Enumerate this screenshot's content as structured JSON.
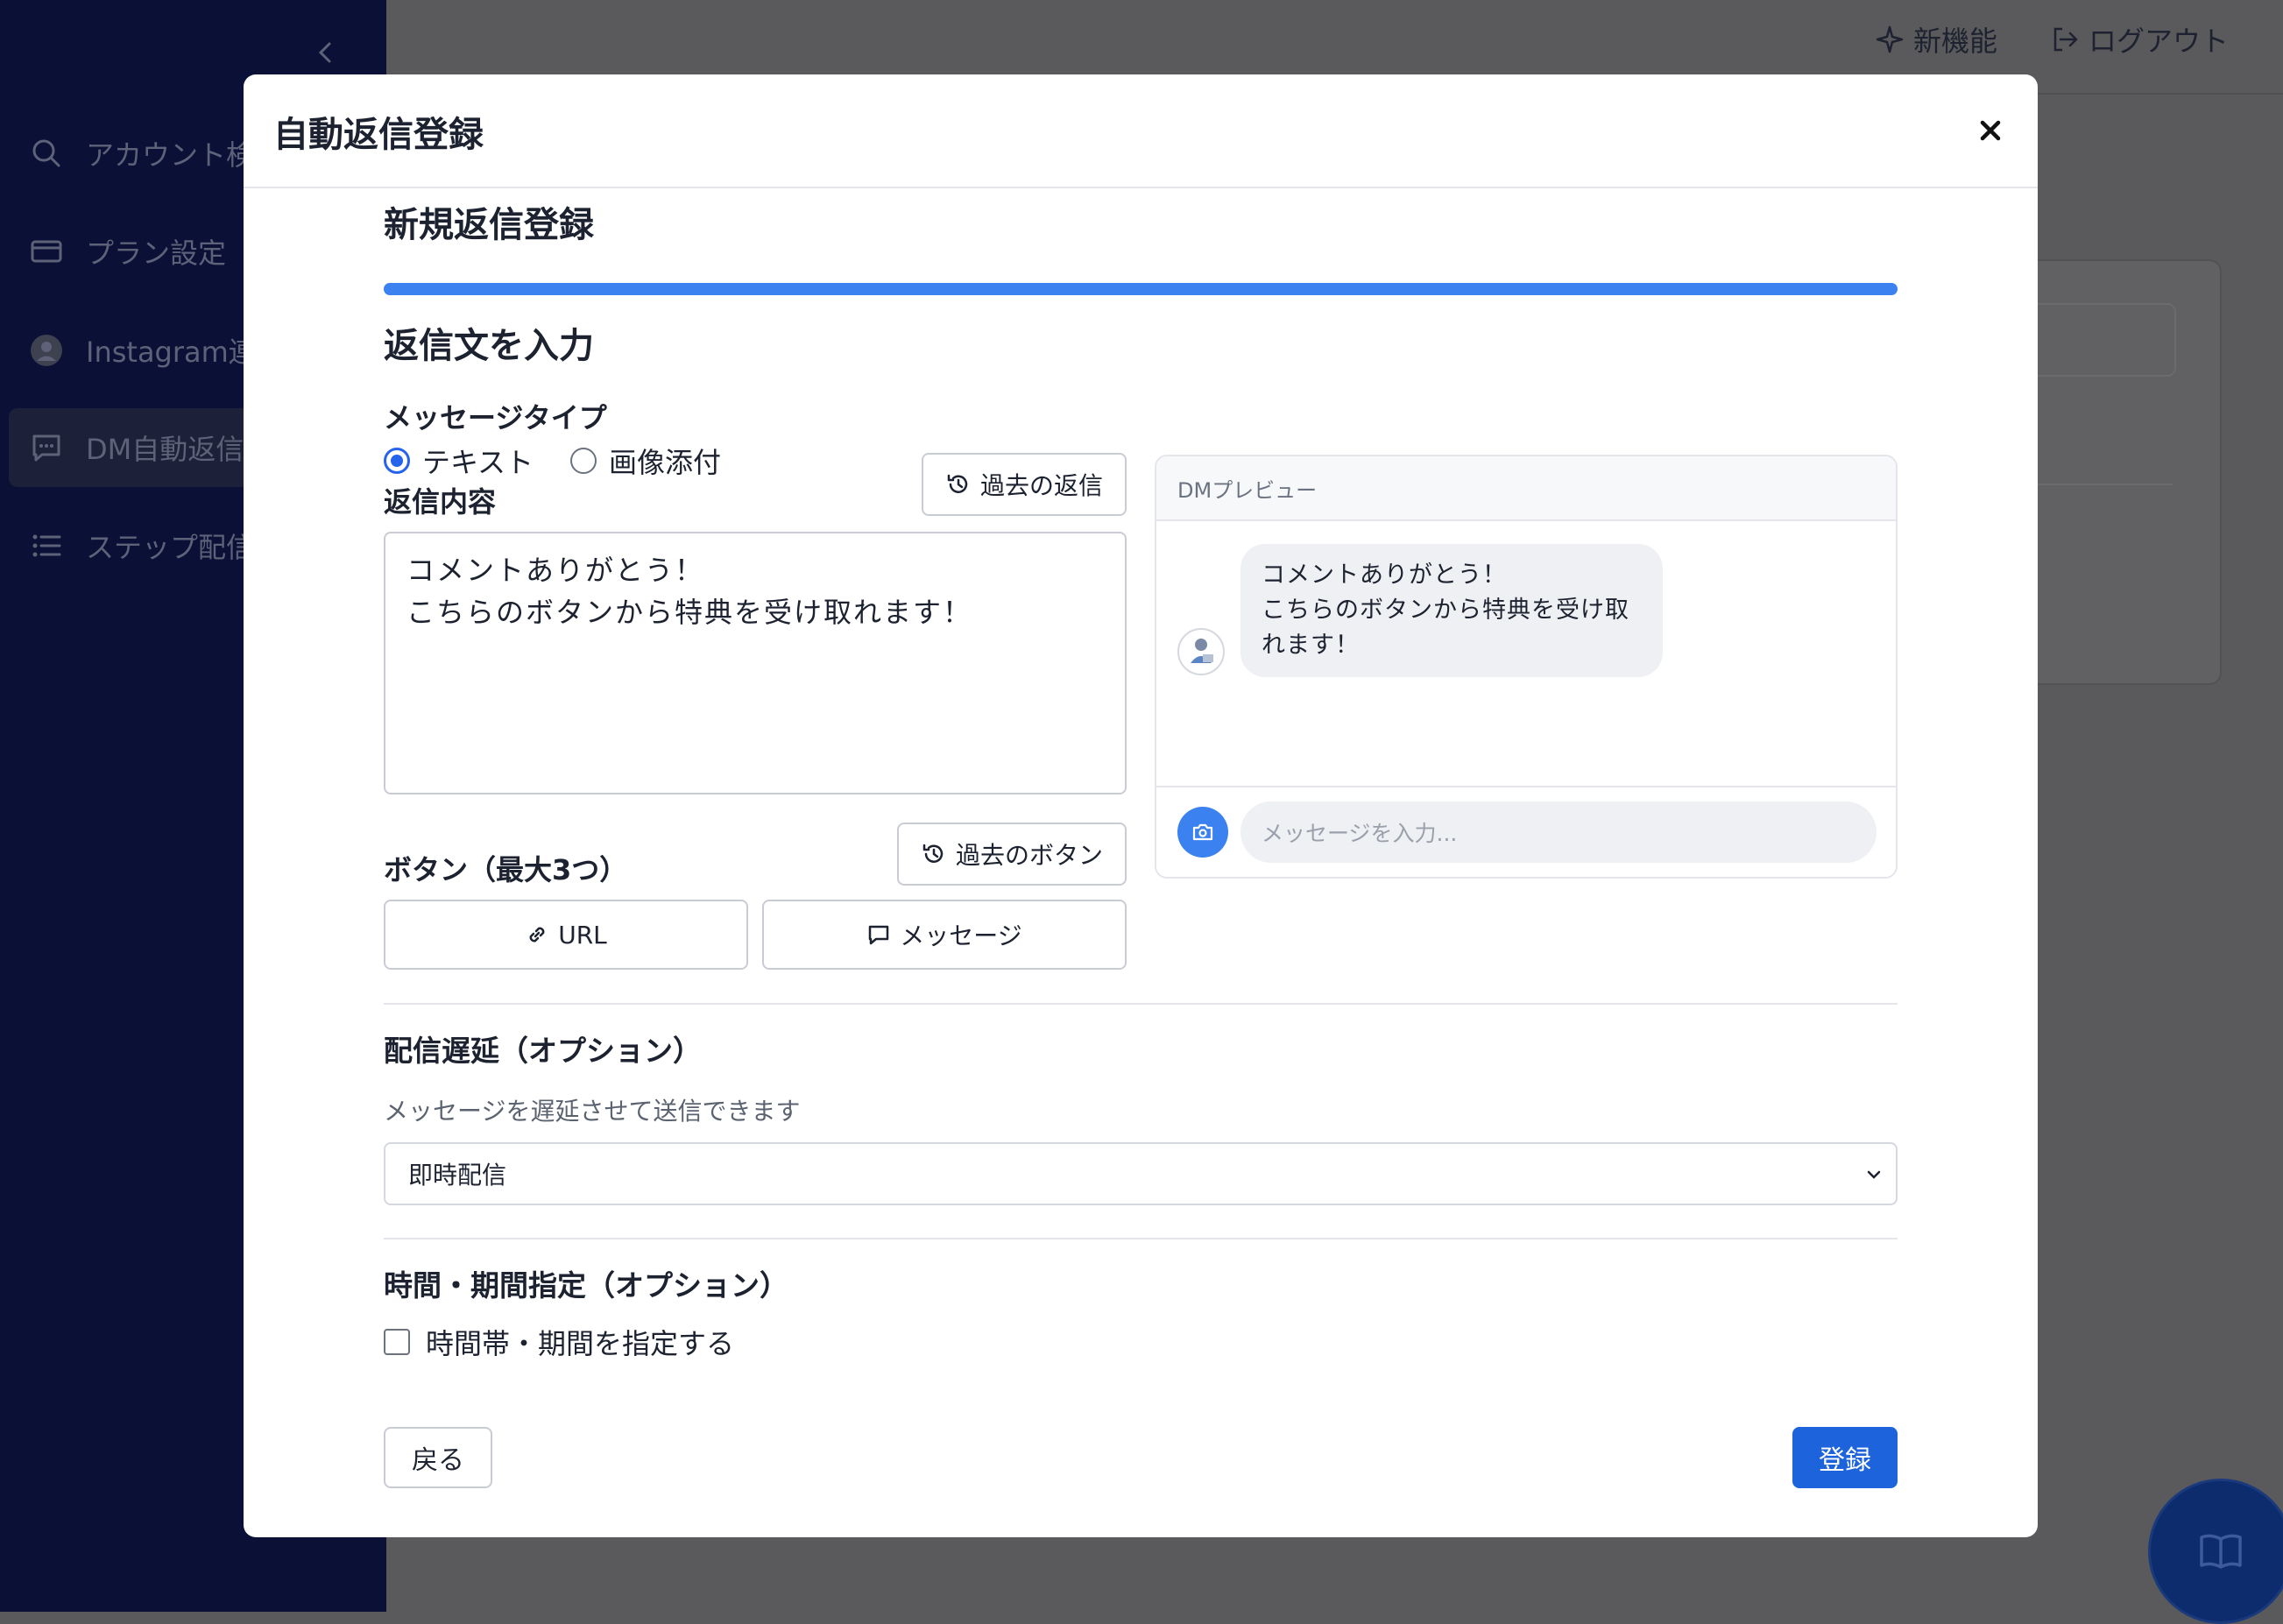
{
  "sidebar": {
    "items": [
      {
        "label": "アカウント検索",
        "icon": "search-icon"
      },
      {
        "label": "プラン設定",
        "icon": "card-icon"
      },
      {
        "label": "Instagram連携",
        "icon": "avatar-icon"
      },
      {
        "label": "DM自動返信",
        "icon": "chat-icon",
        "active": true
      },
      {
        "label": "ステップ配信",
        "icon": "list-icon"
      }
    ]
  },
  "header": {
    "new_features": "新機能",
    "logout": "ログアウト"
  },
  "modal": {
    "title": "自動返信登録",
    "heading": "新規返信登録",
    "progress": 1.0,
    "step_title": "返信文を入力",
    "message_type": {
      "label": "メッセージタイプ",
      "options": [
        "テキスト",
        "画像添付"
      ],
      "selected": "テキスト"
    },
    "reply": {
      "label": "返信内容",
      "past_reply_button": "過去の返信",
      "value": "コメントありがとう！\nこちらのボタンから特典を受け取れます！"
    },
    "buttons_section": {
      "label": "ボタン（最大3つ）",
      "past_buttons": "過去のボタン",
      "url_button": "URL",
      "message_button": "メッセージ"
    },
    "preview": {
      "title": "DMプレビュー",
      "bubble_text": "コメントありがとう！\nこちらのボタンから特典を受け取\nれます！",
      "input_placeholder": "メッセージを入力..."
    },
    "delay": {
      "title": "配信遅延（オプション）",
      "help": "メッセージを遅延させて送信できます",
      "selected": "即時配信"
    },
    "schedule": {
      "title": "時間・期間指定（オプション）",
      "checkbox_label": "時間帯・期間を指定する",
      "checked": false
    },
    "back_button": "戻る",
    "submit_button": "登録"
  },
  "colors": {
    "accent": "#3b82f0",
    "sidebar_bg": "#0a1036",
    "submit": "#1d63dc"
  }
}
